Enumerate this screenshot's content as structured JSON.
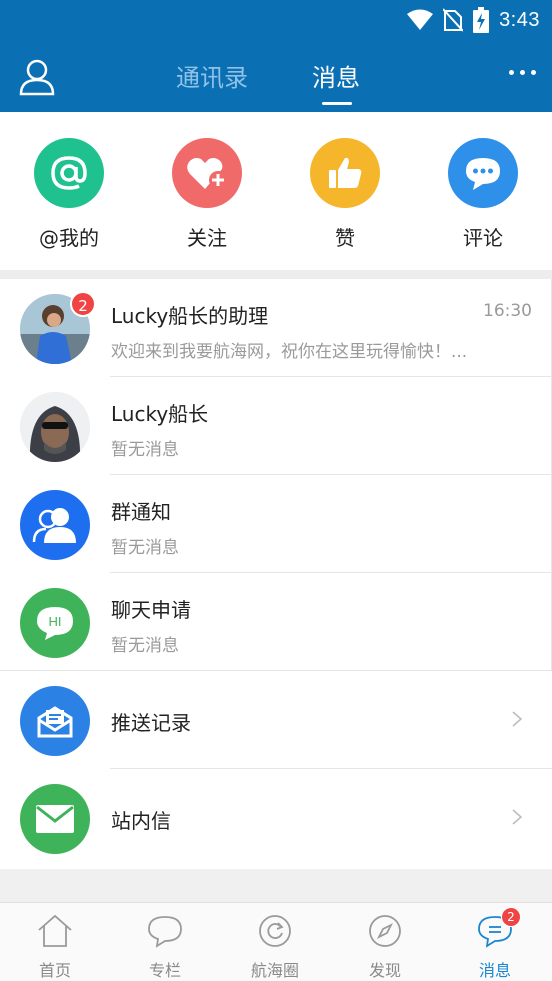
{
  "status_bar": {
    "time": "3:43",
    "icons": [
      "wifi-icon",
      "no-sim-icon",
      "battery-charging-icon"
    ]
  },
  "header": {
    "tabs": [
      {
        "label": "通讯录",
        "active": false
      },
      {
        "label": "消息",
        "active": true
      }
    ],
    "left_icon": "user-icon",
    "right_icon": "more-icon"
  },
  "quick_actions": [
    {
      "label": "@我的",
      "icon": "at-icon",
      "color": "#1fc28f"
    },
    {
      "label": "关注",
      "icon": "heart-plus-icon",
      "color": "#f06a6a"
    },
    {
      "label": "赞",
      "icon": "thumbs-up-icon",
      "color": "#f5b62c"
    },
    {
      "label": "评论",
      "icon": "comment-icon",
      "color": "#2e90e8"
    }
  ],
  "messages": [
    {
      "title": "Lucky船长的助理",
      "subtitle": "欢迎来到我要航海网，祝你在这里玩得愉快！...",
      "time": "16:30",
      "badge": "2"
    },
    {
      "title": "Lucky船长",
      "subtitle": "暂无消息"
    },
    {
      "title": "群通知",
      "subtitle": "暂无消息"
    },
    {
      "title": "聊天申请",
      "subtitle": "暂无消息"
    }
  ],
  "links": [
    {
      "title": "推送记录"
    },
    {
      "title": "站内信"
    }
  ],
  "bottom_nav": [
    {
      "label": "首页",
      "icon": "home-icon",
      "active": false
    },
    {
      "label": "专栏",
      "icon": "speech-bubble-icon",
      "active": false
    },
    {
      "label": "航海圈",
      "icon": "refresh-circle-icon",
      "active": false
    },
    {
      "label": "发现",
      "icon": "compass-icon",
      "active": false
    },
    {
      "label": "消息",
      "icon": "message-icon",
      "active": true,
      "badge": "2"
    }
  ],
  "hi_icon_text": "HI",
  "colors": {
    "primary": "#0b6fb3",
    "accent": "#1a86d0",
    "badge": "#f04444"
  }
}
